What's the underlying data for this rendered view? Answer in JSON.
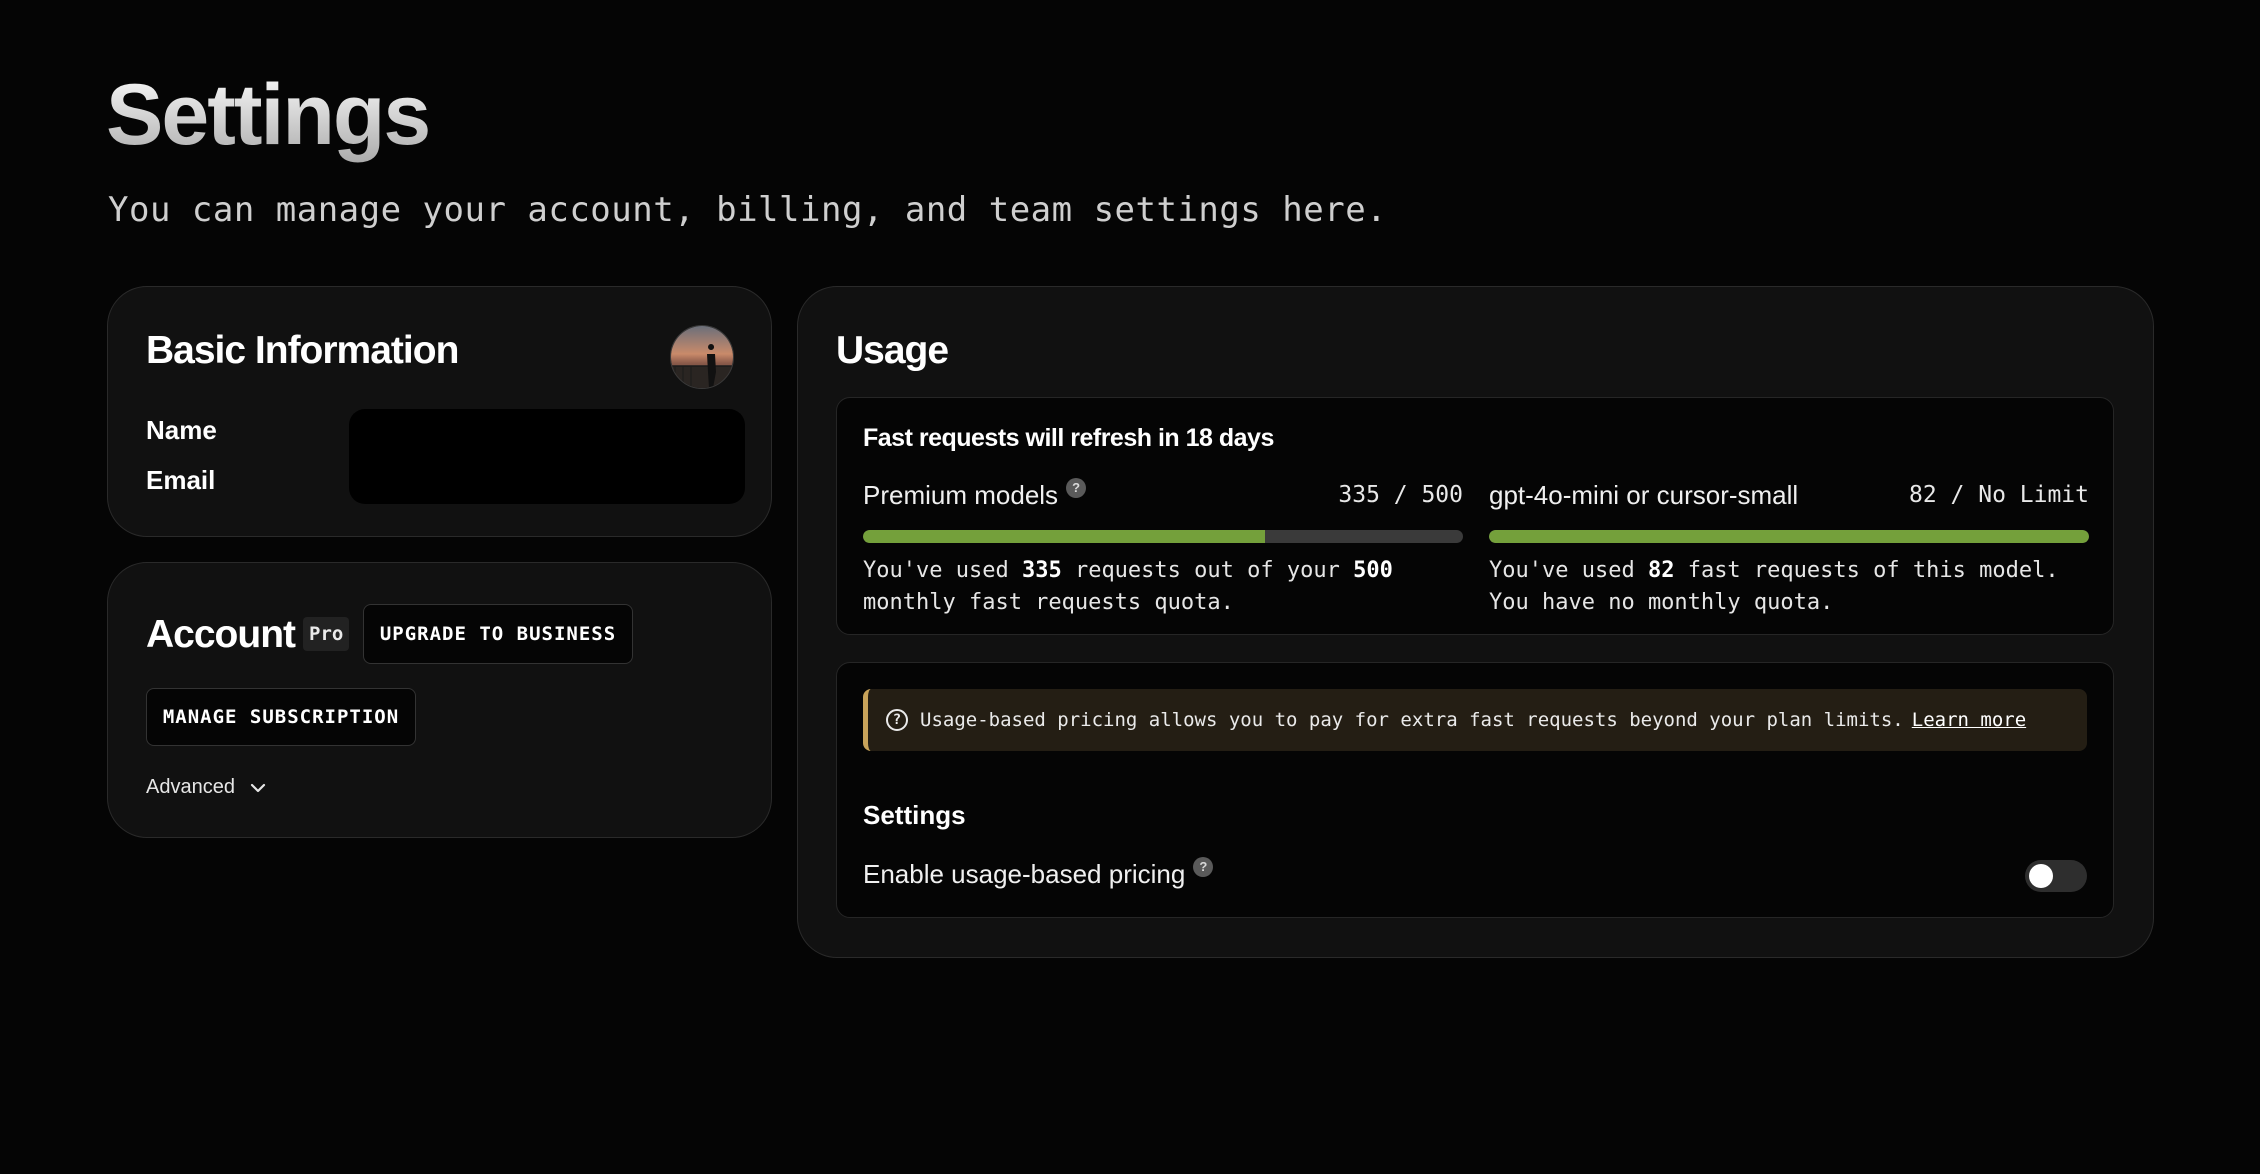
{
  "page": {
    "title": "Settings",
    "subtitle": "You can manage your account, billing, and team settings here."
  },
  "basic_info": {
    "title": "Basic Information",
    "name_label": "Name",
    "email_label": "Email",
    "avatar_icon": "user-avatar"
  },
  "account": {
    "title": "Account",
    "plan_badge": "Pro",
    "upgrade_label": "UPGRADE TO BUSINESS",
    "manage_label": "MANAGE SUBSCRIPTION",
    "advanced_label": "Advanced",
    "advanced_icon": "chevron-down-icon"
  },
  "usage": {
    "title": "Usage",
    "refresh_text": "Fast requests will refresh in 18 days",
    "models": [
      {
        "name": "Premium models",
        "has_help": true,
        "count_text": "335 / 500",
        "used": 335,
        "limit": 500,
        "fill_fraction": 0.67,
        "desc_pre": "You've used ",
        "desc_used": "335",
        "desc_mid": " requests out of your ",
        "desc_limit": "500",
        "desc_post": " monthly fast requests quota."
      },
      {
        "name": "gpt-4o-mini or cursor-small",
        "has_help": false,
        "count_text": "82 / No Limit",
        "used": 82,
        "limit": "No Limit",
        "fill_fraction": 1.0,
        "desc_pre": "You've used ",
        "desc_used": "82",
        "desc_mid": " fast requests of this model. You have no monthly quota.",
        "desc_limit": "",
        "desc_post": ""
      }
    ],
    "bar_color": "#74a03b",
    "bar_track_color": "#3a3a3a"
  },
  "pricing": {
    "notice_text": "Usage-based pricing allows you to pay for extra fast requests beyond your plan limits.",
    "learn_more": "Learn more",
    "notice_icon": "question-circle-icon",
    "settings_title": "Settings",
    "toggle_label": "Enable usage-based pricing",
    "toggle_on": false,
    "accent_color": "#c8a35a"
  }
}
